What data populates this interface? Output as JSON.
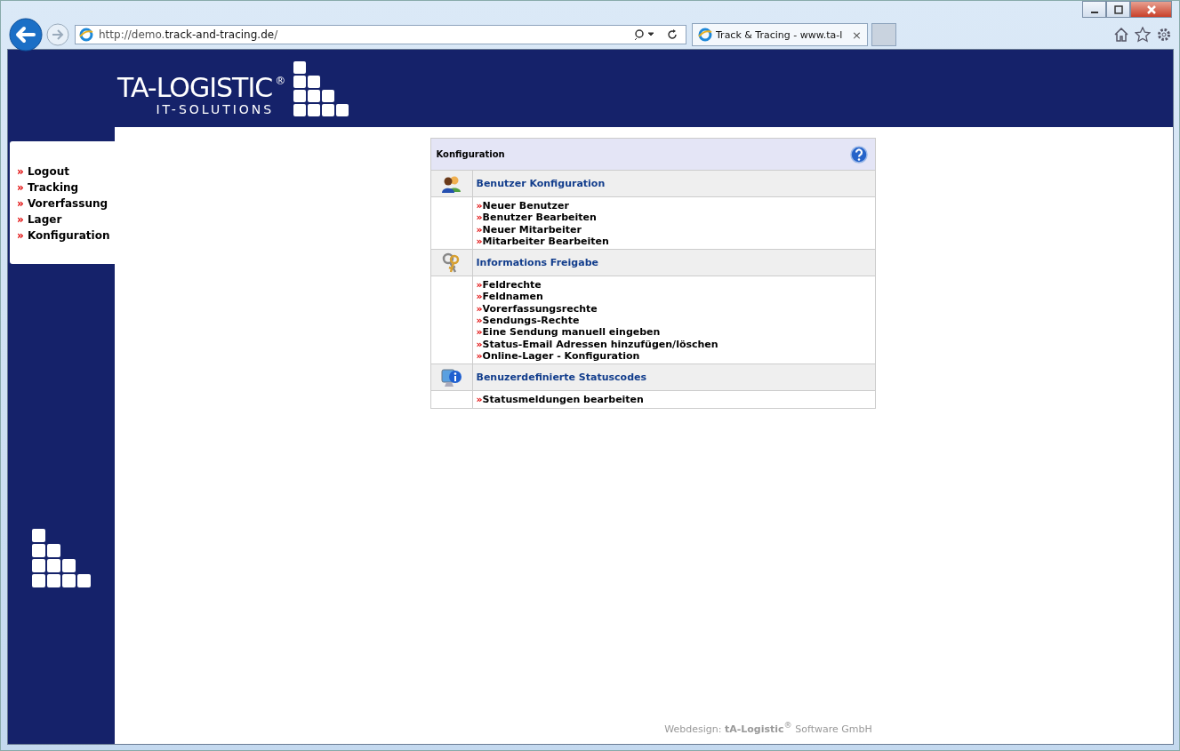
{
  "browser": {
    "url_prefix": "http://demo.",
    "url_domain": "track-and-tracing.de",
    "url_suffix": "/",
    "tab_title": "Track & Tracing - www.ta-l",
    "tab_close": "×"
  },
  "logo": {
    "name": "TA-LOGISTIC",
    "mark": "®",
    "tagline": "IT-SOLUTIONS"
  },
  "sidebar": {
    "items": [
      {
        "bullet": "»",
        "label": "Logout"
      },
      {
        "bullet": "»",
        "label": "Tracking"
      },
      {
        "bullet": "»",
        "label": "Vorerfassung"
      },
      {
        "bullet": "»",
        "label": "Lager"
      },
      {
        "bullet": "»",
        "label": "Konfiguration"
      }
    ]
  },
  "panel": {
    "title": "Konfiguration",
    "sections": [
      {
        "kind": "users",
        "title": "Benutzer Konfiguration",
        "links": [
          {
            "bullet": "»",
            "label": "Neuer Benutzer"
          },
          {
            "bullet": "»",
            "label": "Benutzer Bearbeiten"
          },
          {
            "bullet": "»",
            "label": "Neuer Mitarbeiter"
          },
          {
            "bullet": "»",
            "label": "Mitarbeiter Bearbeiten"
          }
        ]
      },
      {
        "kind": "keys",
        "title": "Informations Freigabe",
        "links": [
          {
            "bullet": "»",
            "label": "Feldrechte"
          },
          {
            "bullet": "»",
            "label": "Feldnamen"
          },
          {
            "bullet": "»",
            "label": "Vorerfassungsrechte"
          },
          {
            "bullet": "»",
            "label": "Sendungs-Rechte"
          },
          {
            "bullet": "»",
            "label": "Eine Sendung manuell eingeben"
          },
          {
            "bullet": "»",
            "label": "Status-Email Adressen hinzufügen/löschen"
          },
          {
            "bullet": "»",
            "label": "Online-Lager - Konfiguration"
          }
        ]
      },
      {
        "kind": "info",
        "title": "Benuzerdefinierte Statuscodes",
        "links": [
          {
            "bullet": "»",
            "label": "Statusmeldungen bearbeiten"
          }
        ]
      }
    ]
  },
  "footer": {
    "text": "Webdesign: **tA-Logistic**$^{®}$ Software GmbH"
  }
}
